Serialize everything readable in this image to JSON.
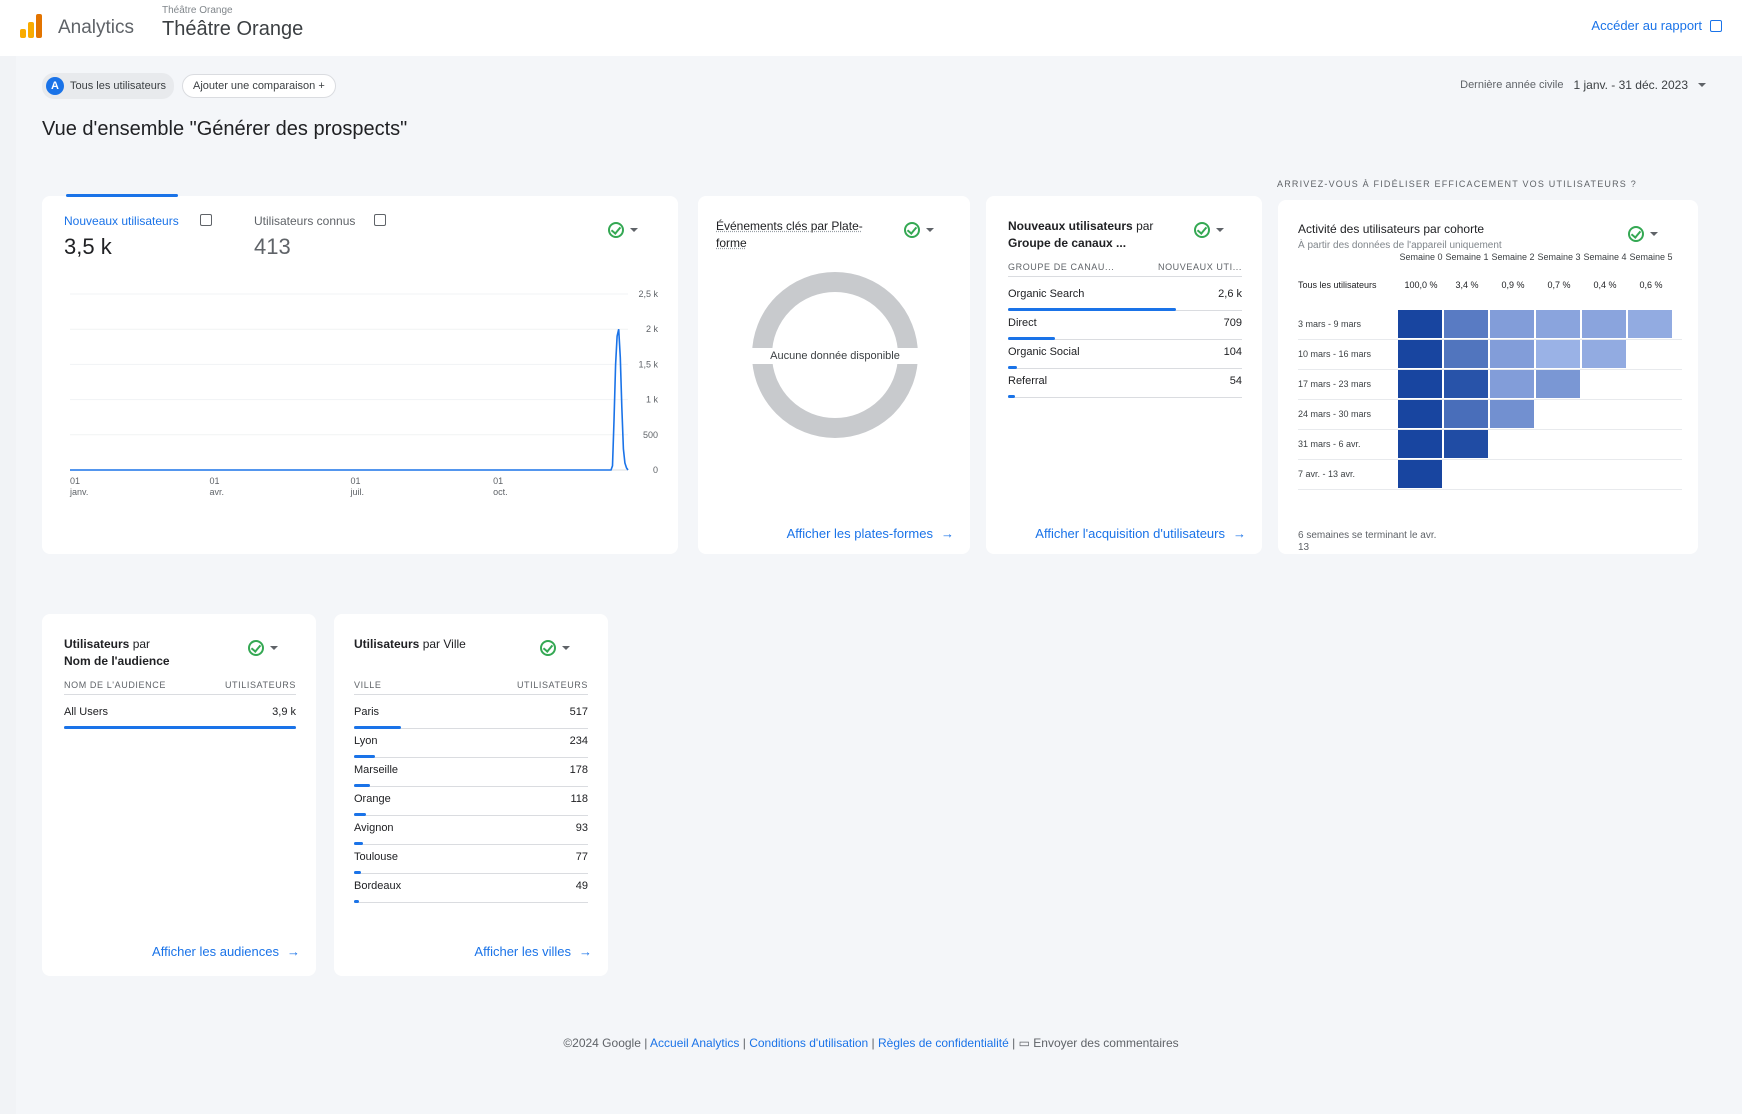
{
  "header": {
    "app_name": "Analytics",
    "property_small": "Théâtre Orange",
    "property_name": "Théâtre Orange",
    "report_link": "Accéder au rapport"
  },
  "toolbar": {
    "segment_label": "Tous les utilisateurs",
    "compare_label": "Ajouter une comparaison",
    "date_label": "Dernière année civile",
    "date_value": "1 janv. - 31 déc. 2023"
  },
  "page_title": "Vue d'ensemble \"Générer des prospects\"",
  "users_card": {
    "tab1_label": "Nouveaux utilisateurs",
    "tab1_value": "3,5 k",
    "tab2_label": "Utilisateurs connus",
    "tab2_value": "413",
    "x_ticks": [
      "01 janv.",
      "01 avr.",
      "01 juil.",
      "01 oct."
    ],
    "y_ticks": [
      "2,5 k",
      "2 k",
      "1,5 k",
      "1 k",
      "500",
      "0"
    ]
  },
  "chart_data": {
    "type": "line",
    "series": [
      {
        "name": "Nouveaux utilisateurs",
        "values": [
          0,
          0,
          0,
          0,
          0,
          0,
          0,
          0,
          0,
          0,
          0,
          0,
          0,
          0,
          0,
          0,
          0,
          0,
          0,
          0,
          0,
          0,
          0,
          0,
          0,
          0,
          0,
          0,
          0,
          0,
          0,
          0,
          0,
          0,
          0,
          0,
          0,
          0,
          0,
          0,
          0,
          0,
          0,
          0,
          0,
          0,
          0,
          0,
          0,
          0,
          0,
          0,
          0,
          0,
          0,
          0,
          0,
          0,
          0,
          0,
          0,
          0,
          0,
          0,
          0,
          0,
          0,
          0,
          0,
          0,
          0,
          0,
          0,
          0,
          0,
          0,
          0,
          0,
          0,
          0,
          0,
          0,
          0,
          0,
          0,
          0,
          0,
          0,
          0,
          0,
          0,
          0,
          0,
          0,
          0,
          0,
          0,
          0,
          0,
          0,
          0,
          0,
          0,
          0,
          0,
          0,
          0,
          0,
          0,
          0,
          0,
          0,
          0,
          0,
          0,
          0,
          0,
          0,
          0,
          0,
          0,
          0,
          0,
          0,
          0,
          0,
          0,
          0,
          0,
          0,
          0,
          0,
          0,
          0,
          0,
          0,
          0,
          0,
          0,
          0,
          0,
          0,
          0,
          0,
          0,
          0,
          0,
          0,
          0,
          0,
          0,
          0,
          0,
          0,
          0,
          0,
          0,
          0,
          0,
          0,
          0,
          0,
          0,
          0,
          0,
          0,
          0,
          0,
          0,
          0,
          0,
          0,
          0,
          0,
          0,
          0,
          0,
          0,
          0,
          0,
          0,
          0,
          0,
          0,
          0,
          0,
          0,
          0,
          0,
          0,
          0,
          0,
          0,
          0,
          0,
          0,
          0,
          0,
          0,
          0,
          0,
          0,
          0,
          0,
          0,
          0,
          0,
          0,
          0,
          0,
          0,
          0,
          0,
          0,
          0,
          0,
          0,
          0,
          0,
          0,
          0,
          0,
          0,
          0,
          0,
          0,
          0,
          0,
          0,
          0,
          0,
          0,
          0,
          0,
          0,
          0,
          0,
          0,
          0,
          0,
          0,
          0,
          0,
          0,
          0,
          0,
          0,
          0,
          0,
          0,
          0,
          0,
          0,
          0,
          0,
          0,
          0,
          0,
          0,
          0,
          0,
          0,
          0,
          0,
          0,
          0,
          0,
          0,
          0,
          0,
          0,
          0,
          0,
          0,
          0,
          0,
          0,
          0,
          0,
          0,
          0,
          0,
          0,
          0,
          0,
          0,
          0,
          0,
          0,
          0,
          0,
          0,
          0,
          0,
          0,
          0,
          0,
          0,
          0,
          0,
          0,
          0,
          0,
          0,
          0,
          0,
          0,
          0,
          0,
          0,
          0,
          0,
          0,
          0,
          0,
          0,
          0,
          0,
          0,
          0,
          0,
          0,
          0,
          0,
          0,
          0,
          0,
          0,
          0,
          0,
          0,
          0,
          0,
          0,
          0,
          0,
          0,
          0,
          0,
          0,
          0,
          0,
          0,
          0,
          0,
          0,
          0,
          0,
          0,
          0,
          60,
          700,
          1500,
          1900,
          2000,
          1600,
          900,
          300,
          100,
          30,
          0
        ]
      }
    ],
    "x_labels": [
      "01 janv.",
      "01 avr.",
      "01 juil.",
      "01 oct."
    ],
    "ylim": [
      0,
      2500
    ]
  },
  "platform_card": {
    "title": "Événements clés par Plate-forme",
    "empty_text": "Aucune donnée disponible",
    "link": "Afficher les plates-formes"
  },
  "channel_card": {
    "title_bold": "Nouveaux utilisateurs",
    "title_rest": "par",
    "title_line2": "Groupe de canaux ...",
    "col1": "GROUPE DE CANAU...",
    "col2": "NOUVEAUX UTI...",
    "rows": [
      {
        "label": "Organic Search",
        "value": "2,6 k",
        "pct": 0.72
      },
      {
        "label": "Direct",
        "value": "709",
        "pct": 0.2
      },
      {
        "label": "Organic Social",
        "value": "104",
        "pct": 0.04
      },
      {
        "label": "Referral",
        "value": "54",
        "pct": 0.03
      }
    ],
    "link": "Afficher l'acquisition d'utilisateurs"
  },
  "cohort_card": {
    "section_title": "ARRIVEZ-VOUS À FIDÉLISER EFFICACEMENT VOS UTILISATEURS ?",
    "title": "Activité des utilisateurs par cohorte",
    "subtitle": "À partir des données de l'appareil uniquement",
    "weeks": [
      "Semaine 0",
      "Semaine 1",
      "Semaine 2",
      "Semaine 3",
      "Semaine 4",
      "Semaine 5"
    ],
    "all_users_label": "Tous les utilisateurs",
    "all_users_values": [
      "100,0 %",
      "3,4 %",
      "0,9 %",
      "0,7 %",
      "0,4 %",
      "0,6 %"
    ],
    "cohorts": [
      {
        "label": "3 mars - 9 mars",
        "levels": [
          1,
          0.6,
          0.35,
          0.3,
          0.3,
          0.25
        ]
      },
      {
        "label": "10 mars - 16 mars",
        "levels": [
          1,
          0.65,
          0.35,
          0.2,
          0.25
        ]
      },
      {
        "label": "17 mars - 23 mars",
        "levels": [
          1,
          0.9,
          0.35,
          0.4
        ]
      },
      {
        "label": "24 mars - 30 mars",
        "levels": [
          1,
          0.7,
          0.45
        ]
      },
      {
        "label": "31 mars - 6 avr.",
        "levels": [
          1,
          0.95
        ]
      },
      {
        "label": "7 avr. - 13 avr.",
        "levels": [
          1
        ]
      }
    ],
    "footer_line1": "6 semaines se terminant le avr.",
    "footer_line2": "13"
  },
  "audience_card": {
    "title_bold": "Utilisateurs",
    "title_rest": "par",
    "title_line2": "Nom de l'audience",
    "col1": "NOM DE L'AUDIENCE",
    "col2": "UTILISATEURS",
    "rows": [
      {
        "label": "All Users",
        "value": "3,9 k",
        "pct": 1.0
      }
    ],
    "link": "Afficher les audiences"
  },
  "city_card": {
    "title_bold": "Utilisateurs",
    "title_rest": "par Ville",
    "col1": "VILLE",
    "col2": "UTILISATEURS",
    "rows": [
      {
        "label": "Paris",
        "value": "517",
        "pct": 0.2
      },
      {
        "label": "Lyon",
        "value": "234",
        "pct": 0.09
      },
      {
        "label": "Marseille",
        "value": "178",
        "pct": 0.07
      },
      {
        "label": "Orange",
        "value": "118",
        "pct": 0.05
      },
      {
        "label": "Avignon",
        "value": "93",
        "pct": 0.04
      },
      {
        "label": "Toulouse",
        "value": "77",
        "pct": 0.03
      },
      {
        "label": "Bordeaux",
        "value": "49",
        "pct": 0.02
      }
    ],
    "link": "Afficher les villes"
  },
  "footer": {
    "copyright": "©2024 Google",
    "links": [
      "Accueil Analytics",
      "Conditions d'utilisation",
      "Règles de confidentialité"
    ],
    "feedback": "Envoyer des commentaires"
  }
}
